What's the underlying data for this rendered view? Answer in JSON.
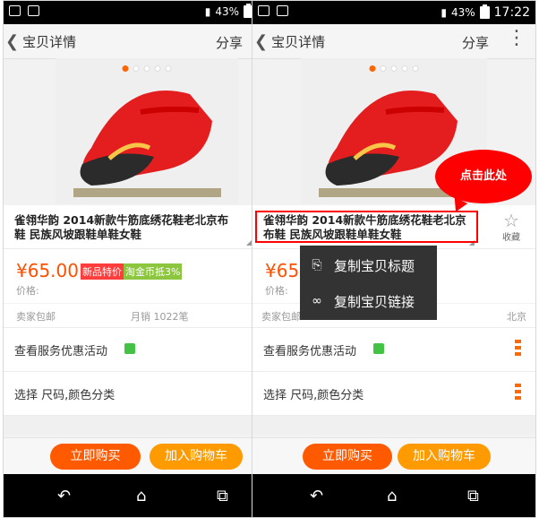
{
  "left": {
    "status": {
      "battery": "43%"
    },
    "nav": {
      "title": "宝贝详情",
      "share": "分享"
    },
    "product": {
      "title": "雀翎华韵 2014新款牛筋底绣花鞋老北京布鞋 民族风坡跟鞋单鞋女鞋",
      "price": "¥65.00",
      "badge_new": "新品特价",
      "badge_coin": "淘金币抵3%",
      "price_label": "价格:",
      "shipping": "卖家包邮",
      "monthly_sales": "月销 1022笔"
    },
    "rows": {
      "service": "查看服务优惠活动",
      "options": "选择 尺码,颜色分类"
    },
    "buttons": {
      "buy": "立即购买",
      "cart": "加入购物车"
    }
  },
  "right": {
    "status": {
      "battery": "43%",
      "time": "17:22"
    },
    "nav": {
      "title": "宝贝详情",
      "share": "分享"
    },
    "product": {
      "title": "雀翎华韵 2014新款牛筋底绣花鞋老北京布鞋 民族风坡跟鞋单鞋女鞋",
      "price_partial": "¥65",
      "price_label": "价格:",
      "shipping": "卖家包邮",
      "location": "北京"
    },
    "favorite": "收藏",
    "popup": {
      "copy_title": "复制宝贝标题",
      "copy_link": "复制宝贝链接"
    },
    "callout": "点击此处",
    "rows": {
      "service": "查看服务优惠活动",
      "options": "选择 尺码,颜色分类"
    },
    "buttons": {
      "buy": "立即购买",
      "cart": "加入购物车"
    }
  },
  "colors": {
    "accent": "#ff5000",
    "buy": "#ff5a00",
    "cart": "#ff9a00",
    "callout": "#ff0000"
  }
}
